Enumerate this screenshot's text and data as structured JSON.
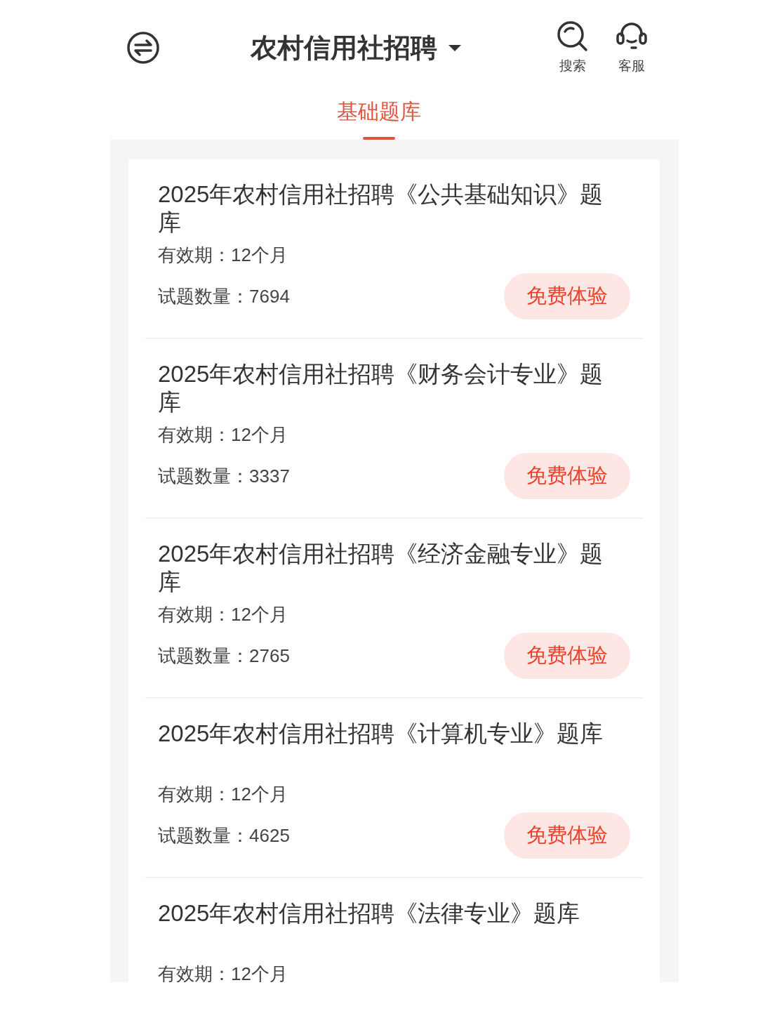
{
  "header": {
    "title": "农村信用社招聘",
    "actions": [
      {
        "label": "搜索",
        "kind": "search"
      },
      {
        "label": "客服",
        "kind": "service"
      }
    ]
  },
  "tabs": [
    {
      "label": "基础题库",
      "selected": true
    }
  ],
  "items": [
    {
      "kind": "full",
      "title": "2025年农村信用社招聘《公共基础知识》题库",
      "validity": "有效期：12个月",
      "count": "试题数量：7694",
      "button": "免费体验"
    },
    {
      "kind": "full",
      "title": "2025年农村信用社招聘《财务会计专业》题库",
      "validity": "有效期：12个月",
      "count": "试题数量：3337",
      "button": "免费体验"
    },
    {
      "kind": "full",
      "title": "2025年农村信用社招聘《经济金融专业》题库",
      "validity": "有效期：12个月",
      "count": "试题数量：2765",
      "button": "免费体验"
    },
    {
      "kind": "full",
      "title": "2025年农村信用社招聘《计算机专业》题库",
      "validity": "有效期：12个月",
      "count": "试题数量：4625",
      "button": "免费体验"
    },
    {
      "kind": "partial",
      "title": "2025年农村信用社招聘《法律专业》题库",
      "validity": "有效期：12个月"
    }
  ]
}
